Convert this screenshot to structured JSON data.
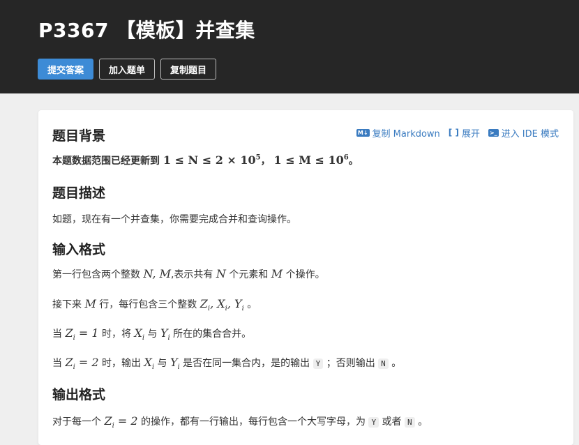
{
  "header": {
    "title": "P3367 【模板】并查集",
    "buttons": {
      "submit": "提交答案",
      "add_list": "加入题单",
      "copy_problem": "复制题目"
    }
  },
  "toolbar": {
    "copy_md_icon": "M↓",
    "copy_md": "复制 Markdown",
    "expand_icon": "[ ]",
    "expand": "展开",
    "ide_icon": ">_",
    "ide": "进入 IDE 模式"
  },
  "sections": {
    "background": {
      "heading": "题目背景",
      "text_pre": "本题数据范围已经更新到",
      "math_1": "1 ≤ N ≤ 2 × 10",
      "exp_1": "5",
      "sep": "，",
      "math_2": "1 ≤ M ≤ 10",
      "exp_2": "6",
      "end": "。"
    },
    "description": {
      "heading": "题目描述",
      "text": "如题，现在有一个并查集，你需要完成合并和查询操作。"
    },
    "input": {
      "heading": "输入格式",
      "l1": {
        "a": "第一行包含两个整数",
        "m1": "N, M",
        "b": ",表示共有",
        "m2": "N",
        "c": "个元素和",
        "m3": "M",
        "d": "个操作。"
      },
      "l2": {
        "a": "接下来",
        "m1": "M",
        "b": "行，每行包含三个整数",
        "m2": "Z",
        "s2": "i",
        "m3": ", X",
        "s3": "i",
        "m4": ", Y",
        "s4": "i",
        "c": "。"
      },
      "l3": {
        "a": "当",
        "m1": "Z",
        "s1": "i",
        "r1": " = 1",
        "b": "时，将",
        "m2": "X",
        "s2": "i",
        "c": "与",
        "m3": "Y",
        "s3": "i",
        "d": "所在的集合合并。"
      },
      "l4": {
        "a": "当",
        "m1": "Z",
        "s1": "i",
        "r1": " = 2",
        "b": "时，输出",
        "m2": "X",
        "s2": "i",
        "c": "与",
        "m3": "Y",
        "s3": "i",
        "d": "是否在同一集合内，是的输出",
        "code1": "Y",
        "e": "；否则输出",
        "code2": "N",
        "f": "。"
      }
    },
    "output": {
      "heading": "输出格式",
      "l1": {
        "a": "对于每一个",
        "m1": "Z",
        "s1": "i",
        "r1": " = 2",
        "b": "的操作，都有一行输出，每行包含一个大写字母，为",
        "code1": "Y",
        "c": "或者",
        "code2": "N",
        "d": "。"
      }
    }
  }
}
